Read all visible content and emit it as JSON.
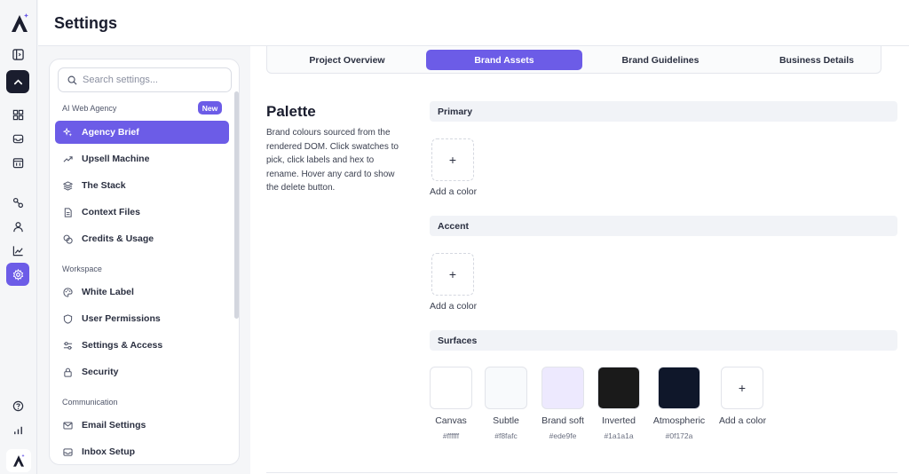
{
  "header": {
    "title": "Settings"
  },
  "search": {
    "placeholder": "Search settings..."
  },
  "nav": {
    "groups": [
      {
        "label": "AI Web Agency",
        "badge": "New"
      },
      {
        "label": "Workspace"
      },
      {
        "label": "Communication"
      }
    ],
    "items": [
      {
        "label": "Agency Brief",
        "icon": "sparkles-icon"
      },
      {
        "label": "Upsell Machine",
        "icon": "trending-up-icon"
      },
      {
        "label": "The Stack",
        "icon": "layers-icon"
      },
      {
        "label": "Context Files",
        "icon": "file-icon"
      },
      {
        "label": "Credits & Usage",
        "icon": "coins-icon"
      },
      {
        "label": "White Label",
        "icon": "palette-icon"
      },
      {
        "label": "User Permissions",
        "icon": "shield-icon"
      },
      {
        "label": "Settings & Access",
        "icon": "sliders-icon"
      },
      {
        "label": "Security",
        "icon": "lock-icon"
      },
      {
        "label": "Email Settings",
        "icon": "mail-icon"
      },
      {
        "label": "Inbox Setup",
        "icon": "inbox-icon"
      }
    ]
  },
  "tabs": [
    {
      "label": "Project Overview"
    },
    {
      "label": "Brand Assets"
    },
    {
      "label": "Brand Guidelines"
    },
    {
      "label": "Business Details"
    }
  ],
  "palette": {
    "title": "Palette",
    "description": "Brand colours sourced from the rendered DOM. Click swatches to pick, click labels and hex to rename. Hover any card to show the delete button.",
    "add_label": "Add a color",
    "sections": [
      {
        "title": "Primary"
      },
      {
        "title": "Accent"
      },
      {
        "title": "Surfaces"
      }
    ],
    "surfaces": [
      {
        "name": "Canvas",
        "hex": "#ffffff"
      },
      {
        "name": "Subtle",
        "hex": "#f8fafc"
      },
      {
        "name": "Brand soft",
        "hex": "#ede9fe"
      },
      {
        "name": "Inverted",
        "hex": "#1a1a1a"
      },
      {
        "name": "Atmospheric",
        "hex": "#0f172a"
      }
    ]
  },
  "colors": {
    "accent": "#6c5ce7",
    "dark": "#1a1d2e"
  }
}
